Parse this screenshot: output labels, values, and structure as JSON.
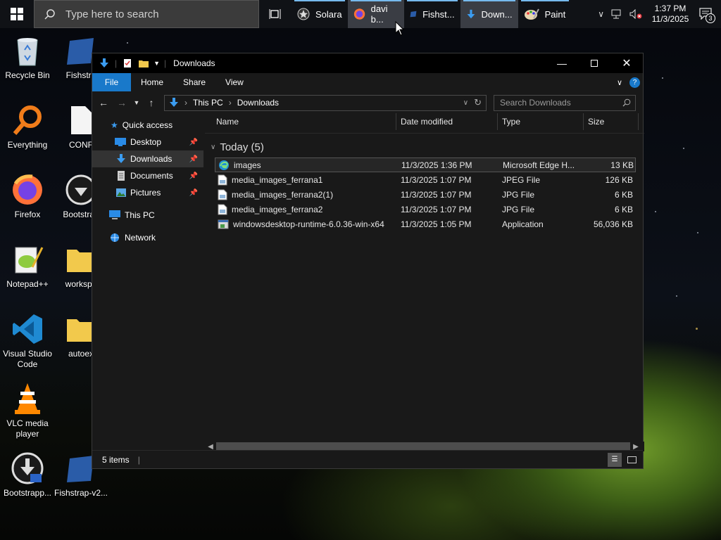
{
  "taskbar": {
    "search_placeholder": "Type here to search",
    "apps": [
      {
        "label": "Solara"
      },
      {
        "label": "davi b..."
      },
      {
        "label": "Fishst..."
      },
      {
        "label": "Down..."
      },
      {
        "label": "Paint"
      }
    ],
    "clock_time": "1:37 PM",
    "clock_date": "11/3/2025",
    "notification_count": "3"
  },
  "desktop": {
    "icons": [
      {
        "label": "Recycle Bin"
      },
      {
        "label": "Fishstra"
      },
      {
        "label": "Everything"
      },
      {
        "label": "CONF"
      },
      {
        "label": "Firefox"
      },
      {
        "label": "Bootstrap"
      },
      {
        "label": "Notepad++"
      },
      {
        "label": "workspa"
      },
      {
        "label": "Visual Studio Code"
      },
      {
        "label": "autoex"
      },
      {
        "label": "VLC media player"
      },
      {
        "label": "Bootstrapp..."
      },
      {
        "label": "Fishstrap-v2..."
      }
    ]
  },
  "explorer": {
    "title": "Downloads",
    "ribbon_tabs": [
      "File",
      "Home",
      "Share",
      "View"
    ],
    "address": {
      "root": "This PC",
      "current": "Downloads"
    },
    "search_placeholder": "Search Downloads",
    "nav": [
      {
        "label": "Quick access"
      },
      {
        "label": "Desktop"
      },
      {
        "label": "Downloads"
      },
      {
        "label": "Documents"
      },
      {
        "label": "Pictures"
      },
      {
        "label": "This PC"
      },
      {
        "label": "Network"
      }
    ],
    "columns": [
      "Name",
      "Date modified",
      "Type",
      "Size"
    ],
    "group_label": "Today (5)",
    "files": [
      {
        "name": "images",
        "date": "11/3/2025 1:36 PM",
        "type": "Microsoft Edge H...",
        "size": "13 KB"
      },
      {
        "name": "media_images_ferrana1",
        "date": "11/3/2025 1:07 PM",
        "type": "JPEG File",
        "size": "126 KB"
      },
      {
        "name": "media_images_ferrana2(1)",
        "date": "11/3/2025 1:07 PM",
        "type": "JPG File",
        "size": "6 KB"
      },
      {
        "name": "media_images_ferrana2",
        "date": "11/3/2025 1:07 PM",
        "type": "JPG File",
        "size": "6 KB"
      },
      {
        "name": "windowsdesktop-runtime-6.0.36-win-x64",
        "date": "11/3/2025 1:05 PM",
        "type": "Application",
        "size": "56,036 KB"
      }
    ],
    "status_items": "5 items"
  },
  "colors": {
    "accent": "#1979ca",
    "taskbar_bg": "#101216",
    "window_bg": "#191919"
  }
}
